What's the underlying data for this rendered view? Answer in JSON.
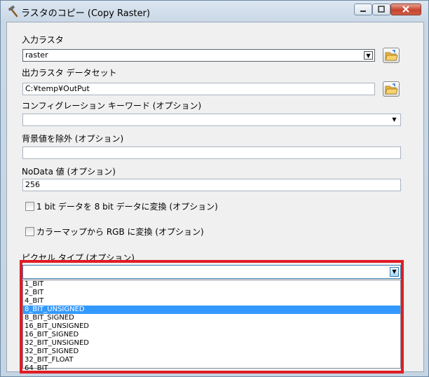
{
  "window": {
    "title": "ラスタのコピー (Copy Raster)"
  },
  "input_raster": {
    "label": "入力ラスタ",
    "value": "raster"
  },
  "output_dataset": {
    "label": "出力ラスタ データセット",
    "value": "C:¥temp¥OutPut"
  },
  "config_keyword": {
    "label": "コンフィグレーション キーワード (オプション)",
    "value": ""
  },
  "background_value": {
    "label": "背景値を除外 (オプション)",
    "value": ""
  },
  "nodata_value": {
    "label": "NoData 値 (オプション)",
    "value": "256"
  },
  "checkbox_1bit": {
    "label": "1 bit データを 8 bit データに変換 (オプション)",
    "checked": false
  },
  "checkbox_colormap": {
    "label": "カラーマップから RGB に変換 (オプション)",
    "checked": false
  },
  "pixel_type": {
    "label": "ピクセル タイプ (オプション)",
    "value": "",
    "options": [
      "1_BIT",
      "2_BIT",
      "4_BIT",
      "8_BIT_UNSIGNED",
      "8_BIT_SIGNED",
      "16_BIT_UNSIGNED",
      "16_BIT_SIGNED",
      "32_BIT_UNSIGNED",
      "32_BIT_SIGNED",
      "32_BIT_FLOAT",
      "64_BIT"
    ],
    "highlighted": "8_BIT_UNSIGNED"
  },
  "colors": {
    "highlight_border": "#e01c24",
    "selection": "#3399ff"
  }
}
